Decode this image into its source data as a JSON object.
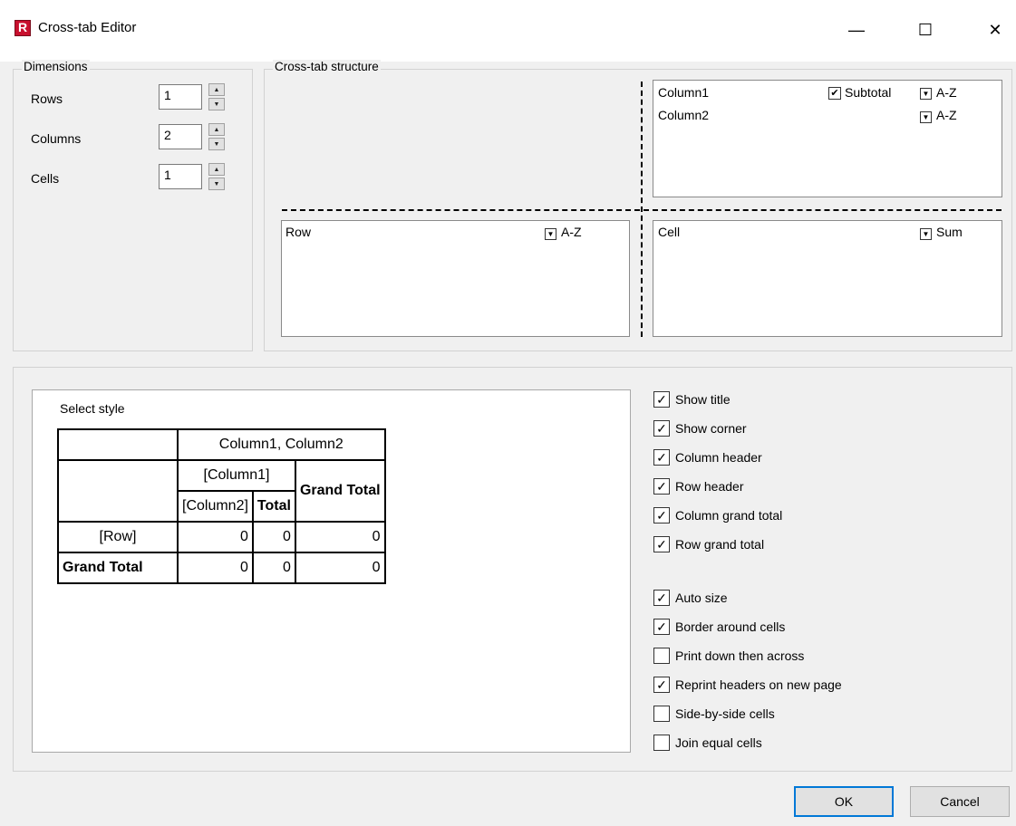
{
  "window": {
    "title": "Cross-tab Editor",
    "icon_letter": "R",
    "minimize_glyph": "—",
    "maximize_glyph": "☐",
    "close_glyph": "✕"
  },
  "dimensions": {
    "legend": "Dimensions",
    "rows": {
      "label": "Rows",
      "value": "1"
    },
    "columns": {
      "label": "Columns",
      "value": "2"
    },
    "cells": {
      "label": "Cells",
      "value": "1"
    }
  },
  "structure": {
    "legend": "Cross-tab structure",
    "columns_list": [
      {
        "name": "Column1",
        "subtotal_label": "Subtotal",
        "subtotal_checked": true,
        "sort": "A-Z"
      },
      {
        "name": "Column2",
        "sort": "A-Z"
      }
    ],
    "rows_list": [
      {
        "name": "Row",
        "sort": "A-Z"
      }
    ],
    "cells_list": [
      {
        "name": "Cell",
        "func": "Sum"
      }
    ]
  },
  "preview": {
    "label": "Select style",
    "header_columns": "Column1, Column2",
    "column1": "[Column1]",
    "column2": "[Column2]",
    "total": "Total",
    "grand_total_col": "Grand Total",
    "row": "[Row]",
    "grand_total_row": "Grand Total",
    "row_values": [
      "0",
      "0",
      "0"
    ],
    "grand_values": [
      "0",
      "0",
      "0"
    ]
  },
  "options": [
    {
      "label": "Show title",
      "checked": true
    },
    {
      "label": "Show corner",
      "checked": true
    },
    {
      "label": "Column header",
      "checked": true
    },
    {
      "label": "Row header",
      "checked": true
    },
    {
      "label": "Column grand total",
      "checked": true
    },
    {
      "label": "Row grand total",
      "checked": true
    }
  ],
  "options2": [
    {
      "label": "Auto size",
      "checked": true
    },
    {
      "label": "Border around cells",
      "checked": true
    },
    {
      "label": "Print down then across",
      "checked": false
    },
    {
      "label": "Reprint headers on new page",
      "checked": true
    },
    {
      "label": "Side-by-side cells",
      "checked": false
    },
    {
      "label": "Join equal cells",
      "checked": false
    }
  ],
  "buttons": {
    "ok": "OK",
    "cancel": "Cancel"
  }
}
